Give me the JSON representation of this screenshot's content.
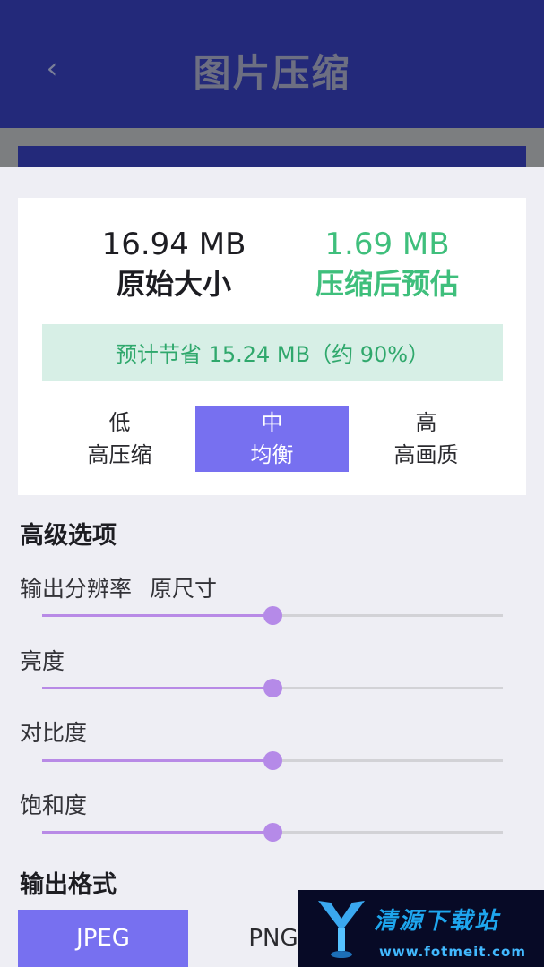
{
  "header": {
    "back_icon": "chevron-left-icon",
    "back_glyph": "‹",
    "title": "图片压缩"
  },
  "colors": {
    "header_bg": "#23297a",
    "accent": "#7770f0",
    "green": "#3fbf7c",
    "slider_fill": "#b88ae6"
  },
  "summary": {
    "original_size": "16.94 MB",
    "original_label": "原始大小",
    "compressed_size": "1.69 MB",
    "compressed_label": "压缩后预估",
    "saving_text": "预计节省 15.24 MB（约 90%）"
  },
  "quality_levels": [
    {
      "name": "低",
      "desc": "高压缩",
      "selected": false
    },
    {
      "name": "中",
      "desc": "均衡",
      "selected": true
    },
    {
      "name": "高",
      "desc": "高画质",
      "selected": false
    }
  ],
  "advanced": {
    "title": "高级选项",
    "resolution": {
      "label": "输出分辨率",
      "value": "原尺寸",
      "level": 0.5
    },
    "brightness": {
      "label": "亮度",
      "level": 0.5
    },
    "contrast": {
      "label": "对比度",
      "level": 0.5
    },
    "saturation": {
      "label": "饱和度",
      "level": 0.5
    }
  },
  "output_format": {
    "title": "输出格式",
    "options": [
      "JPEG",
      "PNG"
    ],
    "selected": "JPEG"
  },
  "watermark": {
    "title": "清源下载站",
    "url": "www.fotmeit.com"
  }
}
